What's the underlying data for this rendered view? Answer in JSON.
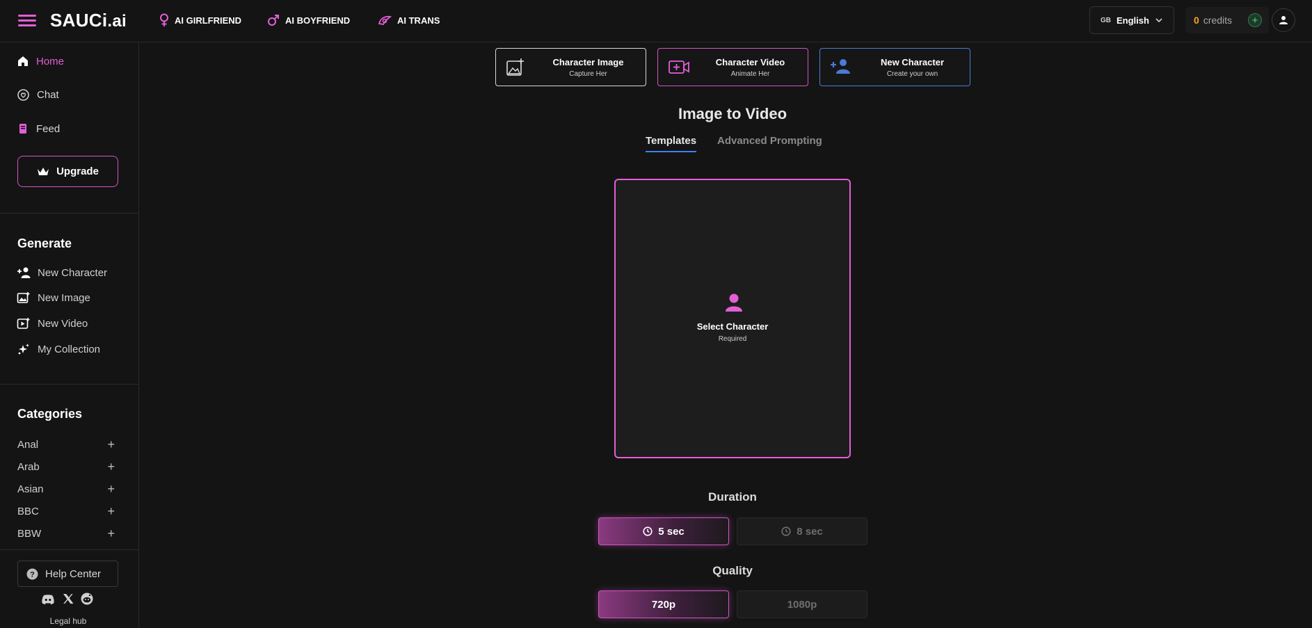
{
  "header": {
    "logo_main": "SAUCi",
    "logo_suffix": ".ai",
    "nav": [
      {
        "label": "AI GIRLFRIEND",
        "icon": "female-icon"
      },
      {
        "label": "AI BOYFRIEND",
        "icon": "male-icon"
      },
      {
        "label": "AI TRANS",
        "icon": "trans-icon"
      }
    ],
    "language": {
      "flag": "GB",
      "label": "English"
    },
    "credits": {
      "count": "0",
      "label": "credits"
    }
  },
  "sidebar": {
    "main": [
      {
        "label": "Home",
        "icon": "home-icon",
        "active": true
      },
      {
        "label": "Chat",
        "icon": "chat-icon"
      },
      {
        "label": "Feed",
        "icon": "feed-icon"
      }
    ],
    "upgrade_label": "Upgrade",
    "generate": {
      "heading": "Generate",
      "items": [
        {
          "label": "New Character",
          "icon": "add-user-icon"
        },
        {
          "label": "New Image",
          "icon": "image-icon"
        },
        {
          "label": "New Video",
          "icon": "video-icon"
        },
        {
          "label": "My Collection",
          "icon": "sparkles-icon"
        }
      ]
    },
    "categories": {
      "heading": "Categories",
      "items": [
        "Anal",
        "Arab",
        "Asian",
        "BBC",
        "BBW"
      ]
    },
    "help_label": "Help Center",
    "legal_label": "Legal hub"
  },
  "main": {
    "cards": [
      {
        "title": "Character Image",
        "subtitle": "Capture Her",
        "border": "#d9d9d9",
        "icon": "image-add-icon"
      },
      {
        "title": "Character Video",
        "subtitle": "Animate Her",
        "border": "#d455c6",
        "icon": "video-add-icon"
      },
      {
        "title": "New Character",
        "subtitle": "Create your own",
        "border": "#4a7bd6",
        "icon": "add-user-icon"
      }
    ],
    "title": "Image to Video",
    "tabs": [
      {
        "label": "Templates",
        "active": true
      },
      {
        "label": "Advanced Prompting",
        "active": false
      }
    ],
    "select": {
      "title": "Select Character",
      "subtitle": "Required"
    },
    "duration": {
      "label": "Duration",
      "options": [
        {
          "label": "5 sec",
          "selected": true
        },
        {
          "label": "8 sec",
          "selected": false
        }
      ]
    },
    "quality": {
      "label": "Quality",
      "options": [
        {
          "label": "720p",
          "selected": true
        },
        {
          "label": "1080p",
          "selected": false
        }
      ]
    }
  },
  "colors": {
    "accent": "#e35fd6",
    "background": "#141414",
    "tab_underline": "#3b82f6",
    "credits_number": "#f5a623"
  }
}
